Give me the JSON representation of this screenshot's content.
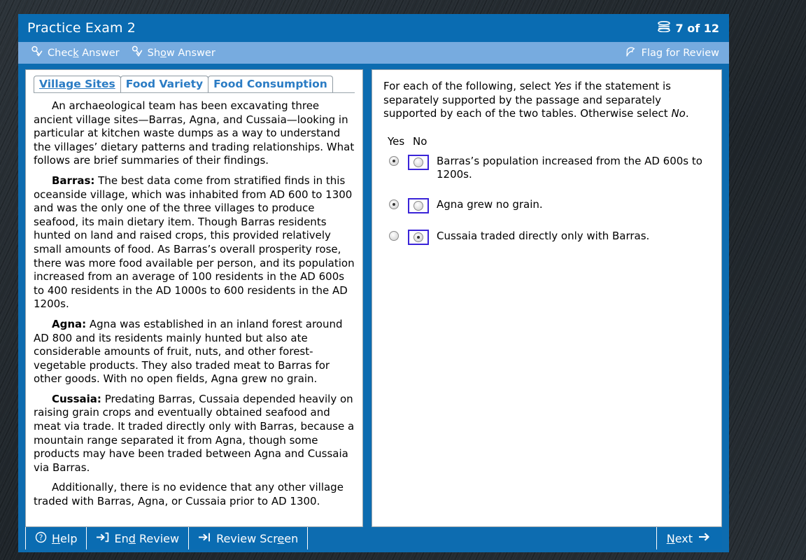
{
  "window": {
    "title": "Practice Exam 2",
    "page_counter": "7 of 12",
    "pages_icon": "stacked-pages-icon"
  },
  "toolbar": {
    "check_answer": {
      "label": "Check Answer",
      "accel": "k",
      "icon": "check-answer-key-icon"
    },
    "show_answer": {
      "label": "Show Answer",
      "accel": "o",
      "icon": "show-answer-key-icon"
    },
    "flag_for_review": {
      "label": "Flag for Review",
      "icon": "flag-icon"
    }
  },
  "tabs": [
    {
      "label": "Village Sites",
      "active": true
    },
    {
      "label": "Food Variety",
      "active": false
    },
    {
      "label": "Food Consumption",
      "active": false
    }
  ],
  "passage": {
    "intro": "An archaeological team has been excavating three ancient village sites—Barras, Agna, and Cussaia—looking in particular at kitchen waste dumps as a way to understand the villages’ dietary patterns and trading relationships. What follows are brief summaries of their findings.",
    "barras_label": "Barras:",
    "barras_text": " The best data come from stratified finds in this oceanside village, which was inhabited from AD 600 to 1300 and was the only one of the three villages to produce seafood, its main dietary item. Though Barras residents hunted on land and raised crops, this provided relatively small amounts of food. As Barras’s overall prosperity rose, there was more food available per person, and its population increased from an average of 100 residents in the AD 600s to 400 residents in the AD 1000s to 600 residents in the AD 1200s.",
    "agna_label": "Agna:",
    "agna_text": " Agna was established in an inland forest around AD 800 and its residents mainly hunted but also ate considerable amounts of fruit, nuts, and other forest-vegetable products. They also traded meat to Barras for other goods. With no open fields, Agna grew no grain.",
    "cussaia_label": "Cussaia:",
    "cussaia_text": " Predating Barras, Cussaia depended heavily on raising grain crops and eventually obtained seafood and meat via trade. It traded directly only with Barras, because a mountain range separated it from Agna, though some products may have been traded between Agna and Cussaia via Barras.",
    "closing": "Additionally, there is no evidence that any other village traded with Barras, Agna, or Cussaia prior to AD 1300."
  },
  "question": {
    "prompt_part1": "For each of the following, select ",
    "prompt_yes": "Yes",
    "prompt_part2": " if the statement is separately supported by the passage and separately supported by each of the two tables. Otherwise select ",
    "prompt_no": "No",
    "prompt_part3": ".",
    "column_headers": {
      "yes": "Yes",
      "no": "No"
    },
    "rows": [
      {
        "statement": "Barras’s population increased from the AD 600s to 1200s.",
        "yes_selected": true,
        "no_selected": false,
        "focus_on": "no"
      },
      {
        "statement": "Agna grew no grain.",
        "yes_selected": true,
        "no_selected": false,
        "focus_on": "no"
      },
      {
        "statement": "Cussaia traded directly only with Barras.",
        "yes_selected": false,
        "no_selected": true,
        "focus_on": "no"
      }
    ]
  },
  "bottom_bar": {
    "help": {
      "label": "Help",
      "accel": "H",
      "icon": "question-circle-icon"
    },
    "end_review": {
      "label": "End Review",
      "accel": "d",
      "icon": "exit-arrow-icon"
    },
    "review_screen": {
      "label": "Review Screen",
      "accel": "e",
      "icon": "arrow-to-bar-icon"
    },
    "next": {
      "label": "Next",
      "accel": "N",
      "icon": "arrow-right-icon"
    }
  },
  "colors": {
    "title_bar": "#0a6cb2",
    "toolbar": "#77abdf",
    "tab_text": "#2b7cc4",
    "focus_outline": "#3a24d8",
    "desktop": "#22282c"
  }
}
